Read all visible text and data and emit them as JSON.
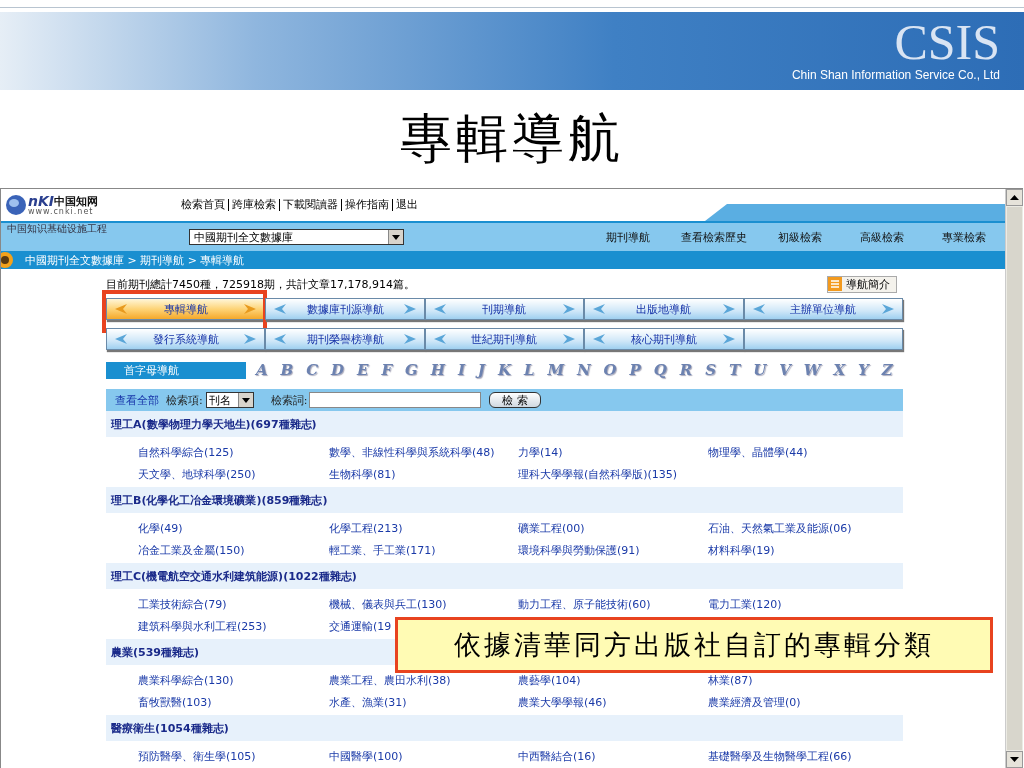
{
  "slide": {
    "brand": "CSIS",
    "company": "Chin Shan Information Service Co., Ltd",
    "title": "專輯導航",
    "callout": "依據清華同方出版社自訂的專輯分類"
  },
  "site": {
    "logo_mark": "nKI",
    "logo_name": "中国知网",
    "logo_url": "www.cnki.net",
    "slogan": "中国知识基础设施工程",
    "top_links": [
      "檢索首頁",
      "跨庫檢索",
      "下載閱讀器",
      "操作指南",
      "退出"
    ],
    "database": "中國期刊全文數據庫",
    "tabs": [
      {
        "label": "期刊導航",
        "selected": false
      },
      {
        "label": "查看檢索歷史",
        "selected": false
      },
      {
        "label": "初級檢索",
        "selected": false
      },
      {
        "label": "高級檢索",
        "selected": false
      },
      {
        "label": "專業檢索",
        "selected": false
      }
    ],
    "breadcrumb": "中國期刊全文數據庫 > 期刊導航 > 專輯導航"
  },
  "stats": "目前期刊總計7450種，725918期，共計文章17,178,914篇。",
  "intro_button": "導航簡介",
  "nav_rows": [
    [
      {
        "label": "專輯導航",
        "selected": true
      },
      {
        "label": "數據庫刊源導航",
        "selected": false
      },
      {
        "label": "刊期導航",
        "selected": false
      },
      {
        "label": "出版地導航",
        "selected": false
      },
      {
        "label": "主辦單位導航",
        "selected": false
      }
    ],
    [
      {
        "label": "發行系統導航",
        "selected": false
      },
      {
        "label": "期刊榮譽榜導航",
        "selected": false
      },
      {
        "label": "世紀期刊導航",
        "selected": false
      },
      {
        "label": "核心期刊導航",
        "selected": false
      }
    ]
  ],
  "alphabet": {
    "label": "首字母導航",
    "letters": [
      "A",
      "B",
      "C",
      "D",
      "E",
      "F",
      "G",
      "H",
      "I",
      "J",
      "K",
      "L",
      "M",
      "N",
      "O",
      "P",
      "Q",
      "R",
      "S",
      "T",
      "U",
      "V",
      "W",
      "X",
      "Y",
      "Z"
    ]
  },
  "search": {
    "view_all": "查看全部",
    "field_label": "檢索項:",
    "field_value": "刊名",
    "term_label": "檢索詞:",
    "button": "檢 索"
  },
  "categories": [
    {
      "title": "理工A(數學物理力學天地生)(697種雜志)",
      "items": [
        "自然科學綜合(125)",
        "數學、非線性科學與系統科學(48)",
        "力學(14)",
        "物理學、晶體學(44)",
        "天文學、地球科學(250)",
        "生物科學(81)",
        "理科大學學報(自然科學版)(135)"
      ]
    },
    {
      "title": "理工B(化學化工冶金環境礦業)(859種雜志)",
      "items": [
        "化學(49)",
        "化學工程(213)",
        "礦業工程(00)",
        "石油、天然氣工業及能源(06)",
        "冶金工業及金屬(150)",
        "輕工業、手工業(171)",
        "環境科學與勞動保護(91)",
        "材料科學(19)"
      ]
    },
    {
      "title": "理工C(機電航空交通水利建筑能源)(1022種雜志)",
      "items": [
        "工業技術綜合(79)",
        "機械、儀表與兵工(130)",
        "動力工程、原子能技術(60)",
        "電力工業(120)",
        "建筑科學與水利工程(253)",
        "交通運輸(19"
      ]
    },
    {
      "title": "農業(539種雜志)",
      "items": [
        "農業科學綜合(130)",
        "農業工程、農田水利(38)",
        "農藝學(104)",
        "林業(87)",
        "畜牧獸醫(103)",
        "水產、漁業(31)",
        "農業大學學報(46)",
        "農業經濟及管理(0)"
      ]
    },
    {
      "title": "醫療衛生(1054種雜志)",
      "items": [
        "預防醫學、衛生學(105)",
        "中國醫學(100)",
        "中西醫結合(16)",
        "基礎醫學及生物醫學工程(66)"
      ]
    }
  ]
}
